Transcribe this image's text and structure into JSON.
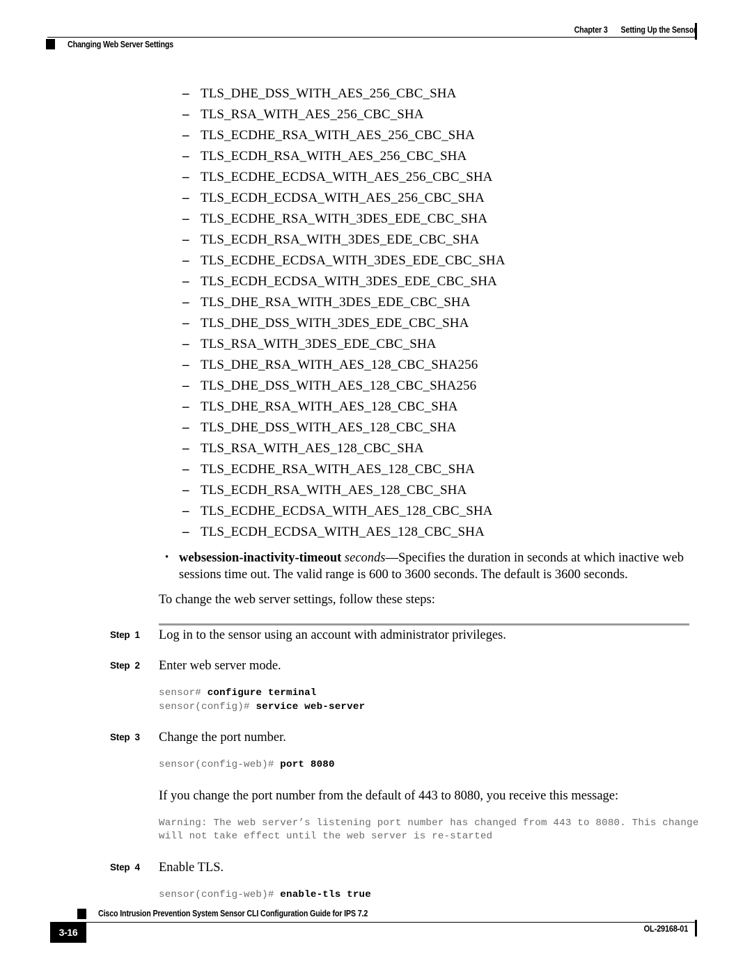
{
  "header": {
    "chapter_label": "Chapter 3",
    "chapter_title": "Setting Up the Sensor",
    "section_title": "Changing Web Server Settings"
  },
  "cipher_suites": [
    "TLS_DHE_DSS_WITH_AES_256_CBC_SHA",
    "TLS_RSA_WITH_AES_256_CBC_SHA",
    "TLS_ECDHE_RSA_WITH_AES_256_CBC_SHA",
    "TLS_ECDH_RSA_WITH_AES_256_CBC_SHA",
    "TLS_ECDHE_ECDSA_WITH_AES_256_CBC_SHA",
    "TLS_ECDH_ECDSA_WITH_AES_256_CBC_SHA",
    "TLS_ECDHE_RSA_WITH_3DES_EDE_CBC_SHA",
    "TLS_ECDH_RSA_WITH_3DES_EDE_CBC_SHA",
    "TLS_ECDHE_ECDSA_WITH_3DES_EDE_CBC_SHA",
    "TLS_ECDH_ECDSA_WITH_3DES_EDE_CBC_SHA",
    "TLS_DHE_RSA_WITH_3DES_EDE_CBC_SHA",
    "TLS_DHE_DSS_WITH_3DES_EDE_CBC_SHA",
    "TLS_RSA_WITH_3DES_EDE_CBC_SHA",
    "TLS_DHE_RSA_WITH_AES_128_CBC_SHA256",
    "TLS_DHE_DSS_WITH_AES_128_CBC_SHA256",
    "TLS_DHE_RSA_WITH_AES_128_CBC_SHA",
    "TLS_DHE_DSS_WITH_AES_128_CBC_SHA",
    "TLS_RSA_WITH_AES_128_CBC_SHA",
    "TLS_ECDHE_RSA_WITH_AES_128_CBC_SHA",
    "TLS_ECDH_RSA_WITH_AES_128_CBC_SHA",
    "TLS_ECDHE_ECDSA_WITH_AES_128_CBC_SHA",
    "TLS_ECDH_ECDSA_WITH_AES_128_CBC_SHA"
  ],
  "list_marker": {
    "dash": "–",
    "bullet": "•"
  },
  "timeout_bullet": {
    "command": "websession-inactivity-timeout",
    "argument": "seconds",
    "description": "—Specifies the duration in seconds at which inactive web sessions time out. The valid range is 600 to 3600 seconds. The default is 3600 seconds."
  },
  "lead_in": "To change the web server settings, follow these steps:",
  "steps": [
    {
      "label": "Step",
      "number": "1",
      "text": "Log in to the sensor using an account with administrator privileges."
    },
    {
      "label": "Step",
      "number": "2",
      "text": "Enter web server mode.",
      "code": [
        {
          "prompt": "sensor# ",
          "command": "configure terminal"
        },
        {
          "prompt": "sensor(config)# ",
          "command": "service web-server"
        }
      ]
    },
    {
      "label": "Step",
      "number": "3",
      "text": "Change the port number.",
      "code": [
        {
          "prompt": "sensor(config-web)# ",
          "command": "port 8080"
        }
      ],
      "note": "If you change the port number from the default of 443 to 8080, you receive this message:",
      "output": "Warning: The web server’s listening port number has changed from 443 to 8080. This change\nwill not take effect until the web server is re-started"
    },
    {
      "label": "Step",
      "number": "4",
      "text": "Enable TLS.",
      "code": [
        {
          "prompt": "sensor(config-web)# ",
          "command": "enable-tls true"
        }
      ]
    }
  ],
  "footer": {
    "page_number": "3-16",
    "book_title": "Cisco Intrusion Prevention System Sensor CLI Configuration Guide for IPS 7.2",
    "doc_number": "OL-29168-01"
  }
}
